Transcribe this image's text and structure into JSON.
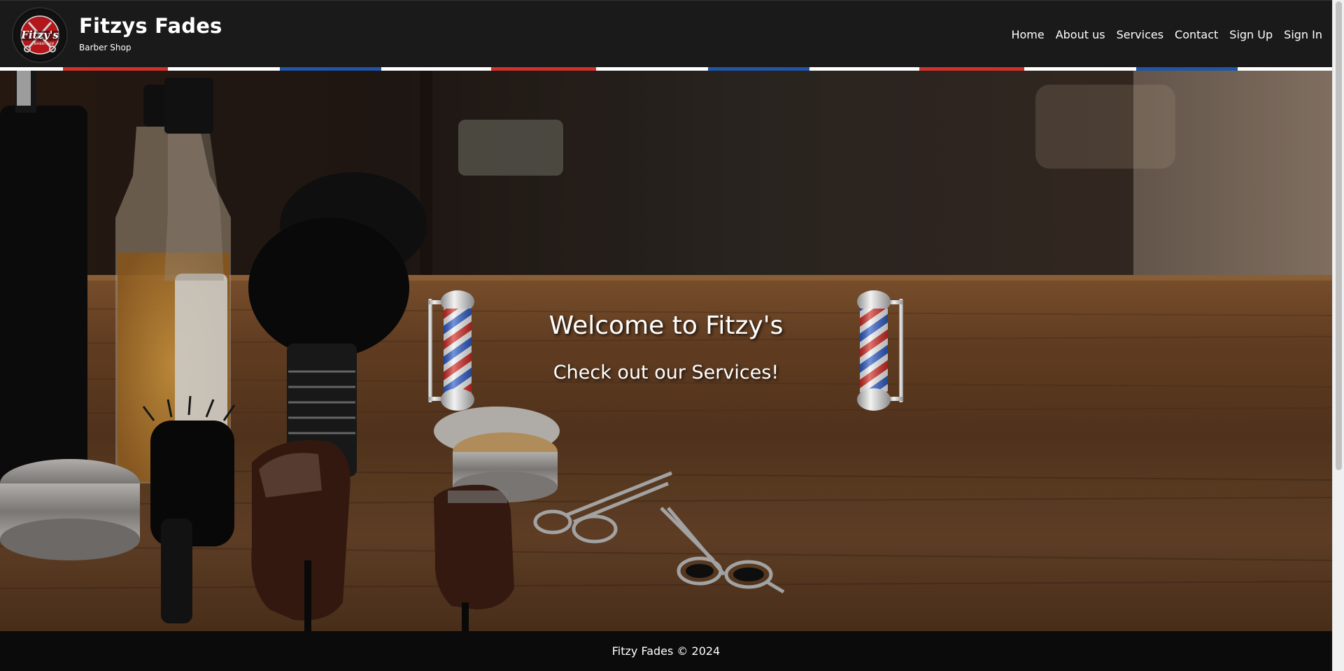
{
  "header": {
    "brand_title": "Fitzys Fades",
    "brand_subtitle": "Barber Shop",
    "logo_text": "Fitzy's",
    "logo_subtext": "BARBER SHOP"
  },
  "nav": {
    "items": [
      {
        "label": "Home"
      },
      {
        "label": "About us"
      },
      {
        "label": "Services"
      },
      {
        "label": "Contact"
      },
      {
        "label": "Sign Up"
      },
      {
        "label": "Sign In"
      }
    ]
  },
  "hero": {
    "title": "Welcome to Fitzy's",
    "subtitle": "Check out our Services!"
  },
  "footer": {
    "text": "Fitzy Fades © 2024"
  },
  "colors": {
    "header_bg": "#1a1a1a",
    "stripe_red": "#d0322a",
    "stripe_blue": "#1f56a8",
    "text": "#ffffff"
  }
}
